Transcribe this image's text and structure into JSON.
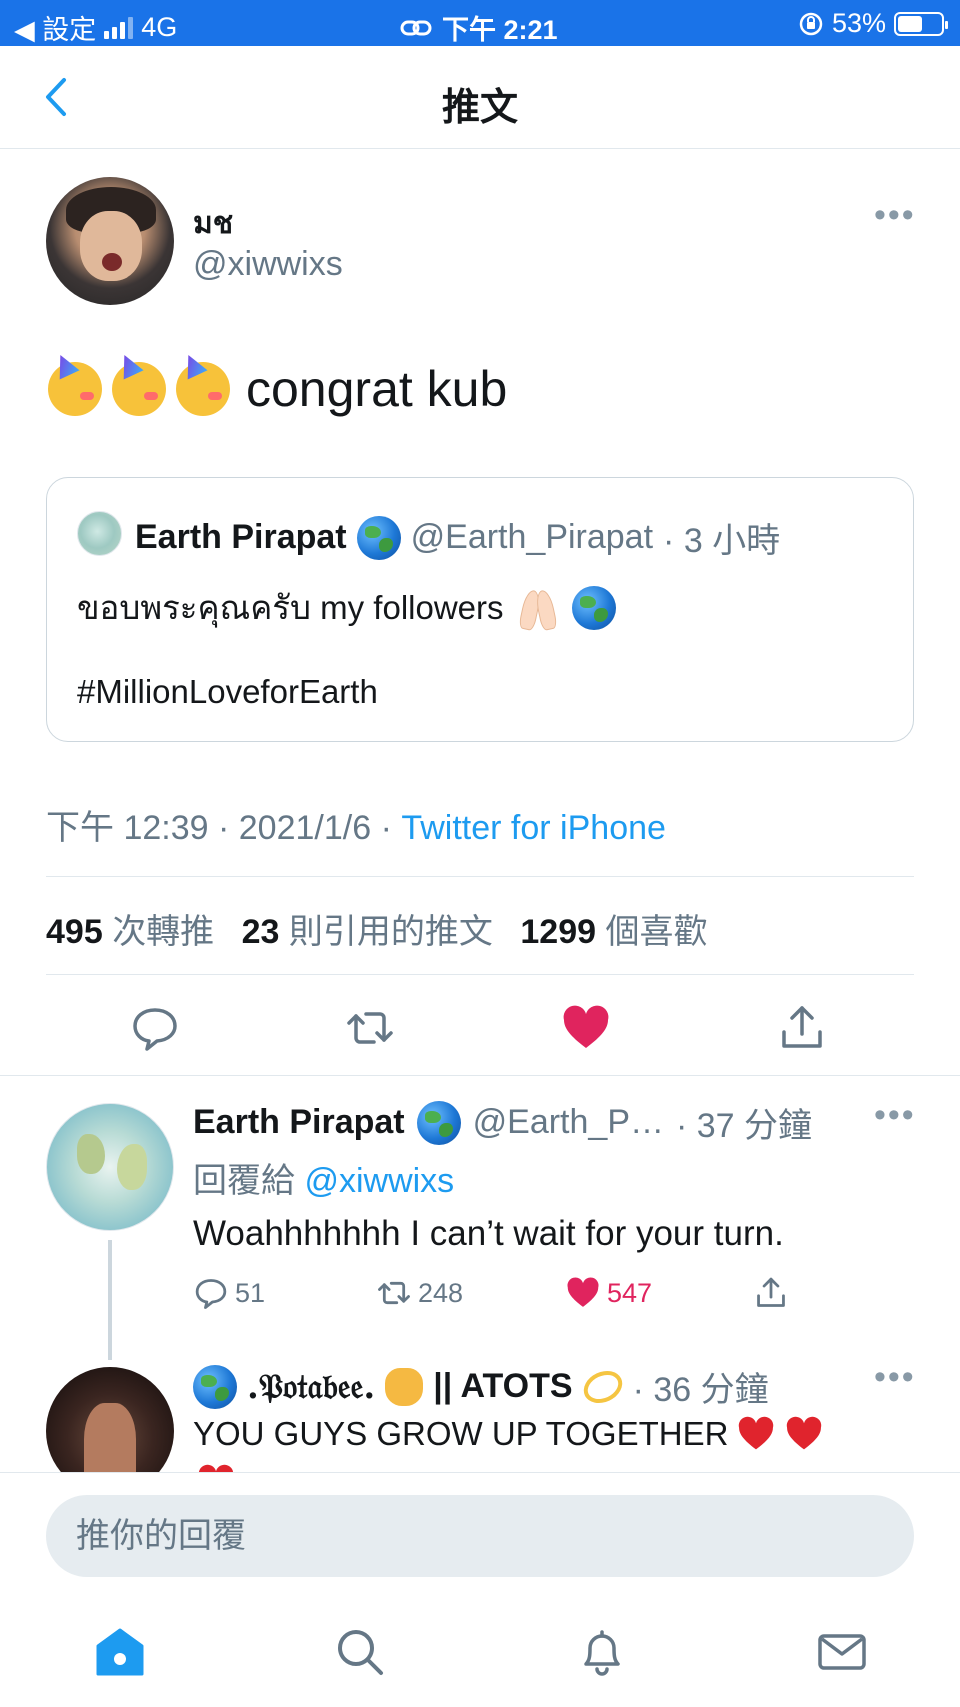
{
  "status_bar": {
    "back_app": "◀ 設定",
    "network": "4G",
    "time": "下午 2:21",
    "battery": "53%"
  },
  "nav": {
    "title": "推文"
  },
  "tweet": {
    "author_name": "มช",
    "author_handle": "@xiwwixs",
    "text": "congrat kub",
    "quote": {
      "name": "Earth Pirapat",
      "handle": "@Earth_Pirapat",
      "time": "· 3 小時",
      "line1": "ขอบพระคุณครับ my followers",
      "line2": "#MillionLoveforEarth"
    },
    "meta": {
      "time": "下午 12:39",
      "sep": "·",
      "date": "2021/1/6",
      "source": "Twitter for iPhone"
    },
    "stats": {
      "retweets": "495",
      "retweets_label": "次轉推",
      "quotes": "23",
      "quotes_label": "則引用的推文",
      "likes": "1299",
      "likes_label": "個喜歡"
    }
  },
  "replies": [
    {
      "name": "Earth Pirapat",
      "handle": "@Earth_P…",
      "time": "· 37 分鐘",
      "reply_to_label": "回覆給",
      "reply_to_handle": "@xiwwixs",
      "text": "Woahhhhhhh I can’t wait for your turn.",
      "replies": "51",
      "retweets": "248",
      "likes": "547"
    },
    {
      "name": ".𝔓𝔬𝔱𝔞𝔟𝔢𝔢.",
      "name_suffix": "|| ATOTS",
      "time": "· 36 分鐘",
      "text": "YOU GUYS GROW UP TOGETHER"
    }
  ],
  "reply_box": {
    "placeholder": "推你的回覆"
  },
  "colors": {
    "accent": "#1d9bf0",
    "like": "#e0245e",
    "status_bar": "#1a73e8",
    "muted": "#657786"
  }
}
